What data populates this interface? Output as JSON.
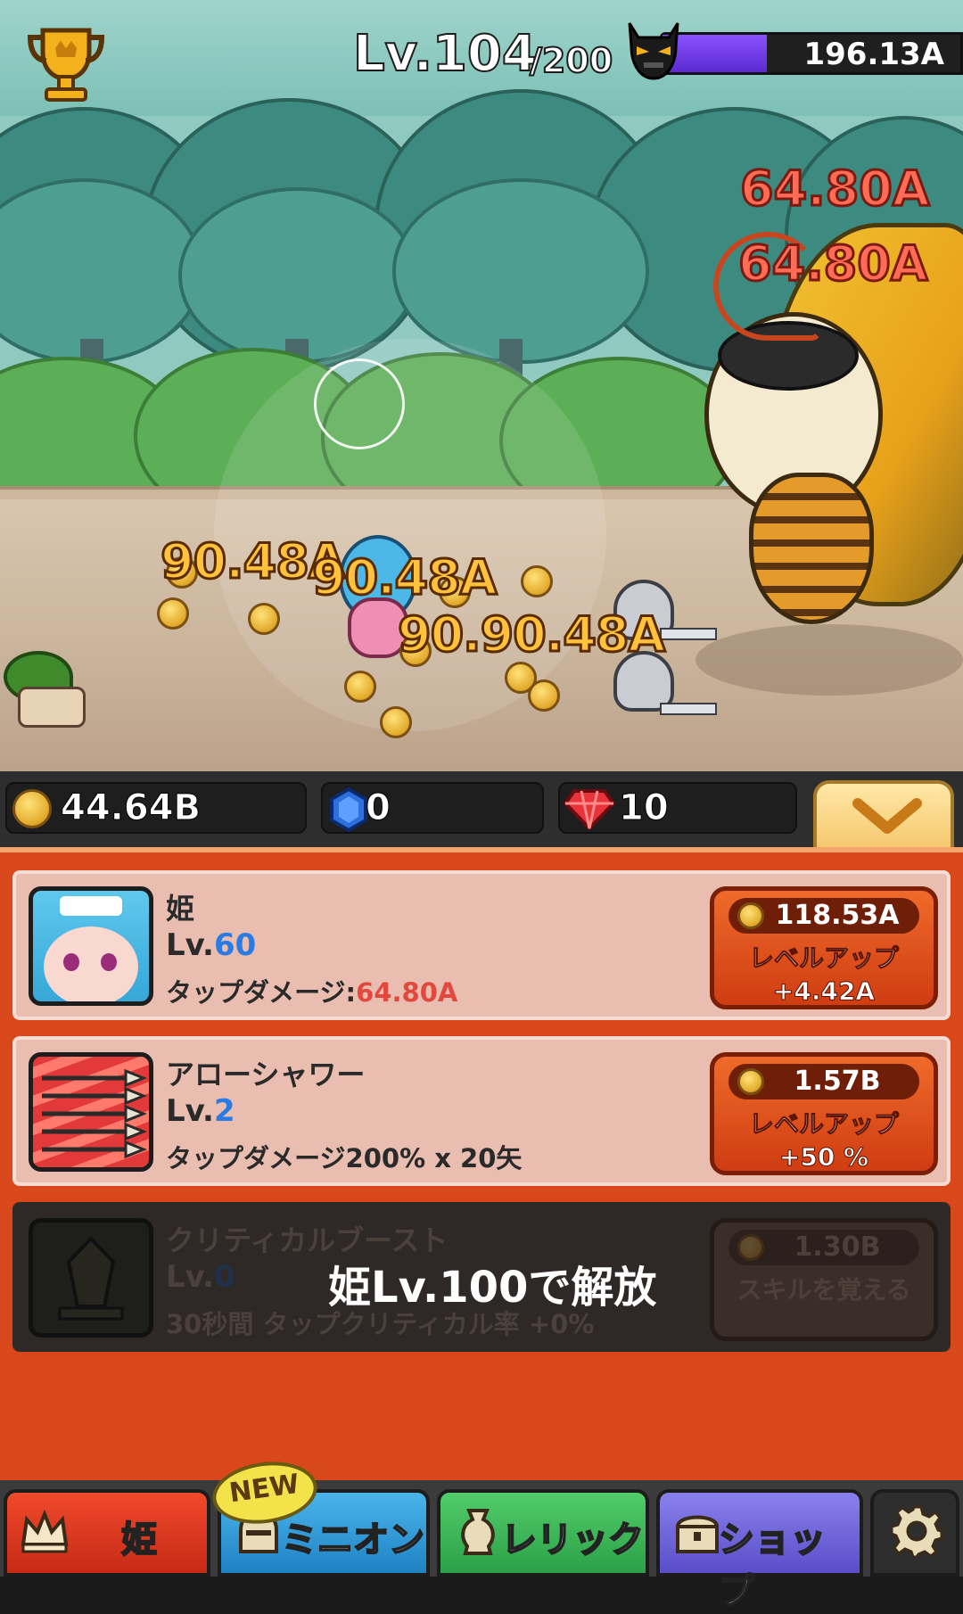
{
  "hud": {
    "level_label": "Lv.",
    "level_value": "104",
    "level_max": "/200",
    "boss_hp": "196.13A",
    "boss_hp_fraction": 0.35
  },
  "scene": {
    "damage_numbers_gold": [
      "90.48A",
      "90.48A",
      "90.90.48A"
    ],
    "damage_numbers_red": [
      "64.80A",
      "64.80A"
    ]
  },
  "currency": {
    "gold": "44.64B",
    "blue_gem": "0",
    "red_gem": "10"
  },
  "skills": [
    {
      "title": "姫",
      "lv_label": "Lv.",
      "lv_value": "60",
      "desc": "タップダメージ:",
      "desc_value": "64.80A",
      "cost": "118.53A",
      "action": "レベルアップ",
      "bonus": "+4.42A"
    },
    {
      "title": "アローシャワー",
      "lv_label": "Lv.",
      "lv_value": "2",
      "desc": "タップダメージ200% x 20矢",
      "cost": "1.57B",
      "action": "レベルアップ",
      "bonus": "+50 %"
    },
    {
      "title": "クリティカルブースト",
      "lv_label": "Lv.",
      "lv_value": "0",
      "desc": "30秒間 タップクリティカル率 +0%",
      "cost": "1.30B",
      "action": "スキルを覚える",
      "unlock": "姫Lv.100で解放"
    }
  ],
  "nav": {
    "tabs": [
      {
        "label": "姫",
        "icon": "crown-icon"
      },
      {
        "label": "ミニオン",
        "icon": "helmet-icon",
        "badge": "NEW"
      },
      {
        "label": "レリック",
        "icon": "vase-icon"
      },
      {
        "label": "ショップ",
        "icon": "treasure-icon"
      }
    ],
    "settings_icon": "gear-icon"
  },
  "colors": {
    "panel": "#d9481a",
    "card": "#e9bdb0",
    "button": "#e2561f",
    "tab_princess": "#d8341c",
    "tab_minion": "#2f9ad6",
    "tab_relic": "#3bb556",
    "tab_shop": "#6d63d8",
    "boss_bar": "#7a3cf0"
  }
}
